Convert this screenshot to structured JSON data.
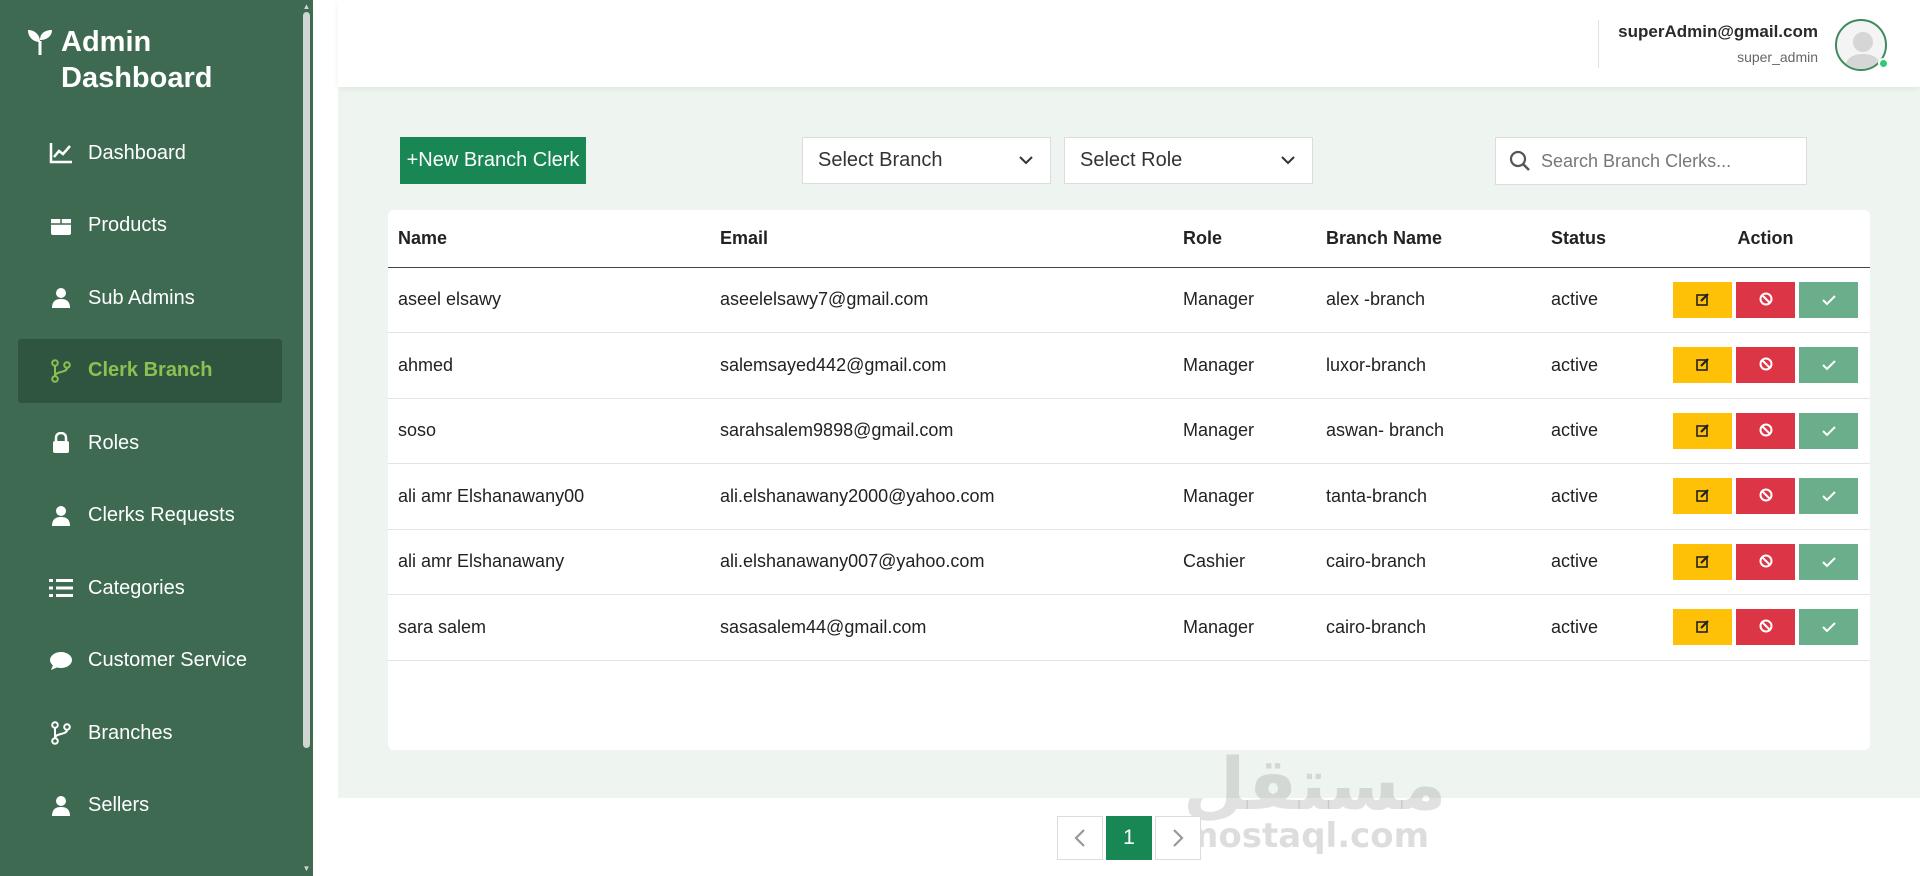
{
  "brand": {
    "title": "Admin Dashboard",
    "icon": "leaf-icon"
  },
  "sidebar": {
    "items": [
      {
        "label": "Dashboard",
        "icon": "chart-line-icon",
        "active": false
      },
      {
        "label": "Products",
        "icon": "box-icon",
        "active": false
      },
      {
        "label": "Sub Admins",
        "icon": "user-icon",
        "active": false
      },
      {
        "label": "Clerk Branch",
        "icon": "branch-icon",
        "active": true
      },
      {
        "label": "Roles",
        "icon": "lock-icon",
        "active": false
      },
      {
        "label": "Clerks Requests",
        "icon": "user-icon",
        "active": false
      },
      {
        "label": "Categories",
        "icon": "list-icon",
        "active": false
      },
      {
        "label": "Customer Service",
        "icon": "chat-icon",
        "active": false
      },
      {
        "label": "Branches",
        "icon": "branch-icon",
        "active": false
      },
      {
        "label": "Sellers",
        "icon": "user-icon",
        "active": false
      }
    ]
  },
  "header": {
    "email": "superAdmin@gmail.com",
    "role": "super_admin"
  },
  "toolbar": {
    "new_button": "+New Branch Clerk",
    "branch_select": "Select Branch",
    "role_select": "Select Role",
    "search_placeholder": "Search Branch Clerks..."
  },
  "table": {
    "columns": [
      "Name",
      "Email",
      "Role",
      "Branch Name",
      "Status",
      "Action"
    ],
    "rows": [
      {
        "name": "aseel elsawy",
        "email": "aseelelsawy7@gmail.com",
        "role": "Manager",
        "branch": "alex -branch",
        "status": "active"
      },
      {
        "name": "ahmed",
        "email": "salemsayed442@gmail.com",
        "role": "Manager",
        "branch": "luxor-branch",
        "status": "active"
      },
      {
        "name": "soso",
        "email": "sarahsalem9898@gmail.com",
        "role": "Manager",
        "branch": "aswan- branch",
        "status": "active"
      },
      {
        "name": "ali amr Elshanawany00",
        "email": "ali.elshanawany2000@yahoo.com",
        "role": "Manager",
        "branch": "tanta-branch",
        "status": "active"
      },
      {
        "name": "ali amr Elshanawany",
        "email": "ali.elshanawany007@yahoo.com",
        "role": "Cashier",
        "branch": "cairo-branch",
        "status": "active"
      },
      {
        "name": "sara salem",
        "email": "sasasalem44@gmail.com",
        "role": "Manager",
        "branch": "cairo-branch",
        "status": "active"
      }
    ]
  },
  "pagination": {
    "current": "1",
    "prev_icon": "chevron-left-icon",
    "next_icon": "chevron-right-icon"
  },
  "watermark": {
    "arabic": "مستقل",
    "latin": "mostaql.com"
  },
  "colors": {
    "sidebar": "#3d6a50",
    "active_item_bg": "#2f5440",
    "active_item_text": "#8cc152",
    "primary": "#198754",
    "edit": "#ffc107",
    "block": "#dc3545",
    "approve": "#6aae8b",
    "content_bg": "#eef4ef"
  }
}
